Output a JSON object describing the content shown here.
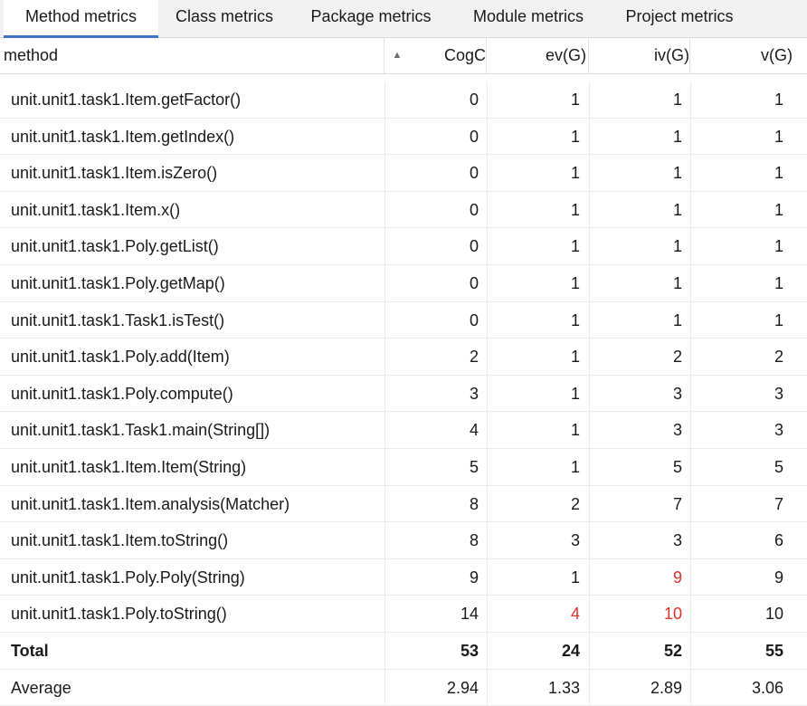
{
  "tabs": [
    {
      "label": "Method metrics",
      "active": true
    },
    {
      "label": "Class metrics",
      "active": false
    },
    {
      "label": "Package metrics",
      "active": false
    },
    {
      "label": "Module metrics",
      "active": false
    },
    {
      "label": "Project metrics",
      "active": false
    }
  ],
  "columns": {
    "method": "method",
    "cogc": "CogC",
    "ev": "ev(G)",
    "iv": "iv(G)",
    "v": "v(G)"
  },
  "sort_indicator": "▲",
  "highlight_color": "#e0312a",
  "rows": [
    {
      "method": "unit.unit1.task1.Item.getFactor()",
      "cogc": "0",
      "ev": "1",
      "iv": "1",
      "v": "1"
    },
    {
      "method": "unit.unit1.task1.Item.getIndex()",
      "cogc": "0",
      "ev": "1",
      "iv": "1",
      "v": "1"
    },
    {
      "method": "unit.unit1.task1.Item.isZero()",
      "cogc": "0",
      "ev": "1",
      "iv": "1",
      "v": "1"
    },
    {
      "method": "unit.unit1.task1.Item.x()",
      "cogc": "0",
      "ev": "1",
      "iv": "1",
      "v": "1"
    },
    {
      "method": "unit.unit1.task1.Poly.getList()",
      "cogc": "0",
      "ev": "1",
      "iv": "1",
      "v": "1"
    },
    {
      "method": "unit.unit1.task1.Poly.getMap()",
      "cogc": "0",
      "ev": "1",
      "iv": "1",
      "v": "1"
    },
    {
      "method": "unit.unit1.task1.Task1.isTest()",
      "cogc": "0",
      "ev": "1",
      "iv": "1",
      "v": "1"
    },
    {
      "method": "unit.unit1.task1.Poly.add(Item)",
      "cogc": "2",
      "ev": "1",
      "iv": "2",
      "v": "2"
    },
    {
      "method": "unit.unit1.task1.Poly.compute()",
      "cogc": "3",
      "ev": "1",
      "iv": "3",
      "v": "3"
    },
    {
      "method": "unit.unit1.task1.Task1.main(String[])",
      "cogc": "4",
      "ev": "1",
      "iv": "3",
      "v": "3"
    },
    {
      "method": "unit.unit1.task1.Item.Item(String)",
      "cogc": "5",
      "ev": "1",
      "iv": "5",
      "v": "5"
    },
    {
      "method": "unit.unit1.task1.Item.analysis(Matcher)",
      "cogc": "8",
      "ev": "2",
      "iv": "7",
      "v": "7"
    },
    {
      "method": "unit.unit1.task1.Item.toString()",
      "cogc": "8",
      "ev": "3",
      "iv": "3",
      "v": "6"
    },
    {
      "method": "unit.unit1.task1.Poly.Poly(String)",
      "cogc": "9",
      "ev": "1",
      "iv": "9",
      "v": "9",
      "red": [
        "iv"
      ]
    },
    {
      "method": "unit.unit1.task1.Poly.toString()",
      "cogc": "14",
      "ev": "4",
      "iv": "10",
      "v": "10",
      "red": [
        "ev",
        "iv"
      ]
    }
  ],
  "total": {
    "method": "Total",
    "cogc": "53",
    "ev": "24",
    "iv": "52",
    "v": "55"
  },
  "average": {
    "method": "Average",
    "cogc": "2.94",
    "ev": "1.33",
    "iv": "2.89",
    "v": "3.06"
  }
}
